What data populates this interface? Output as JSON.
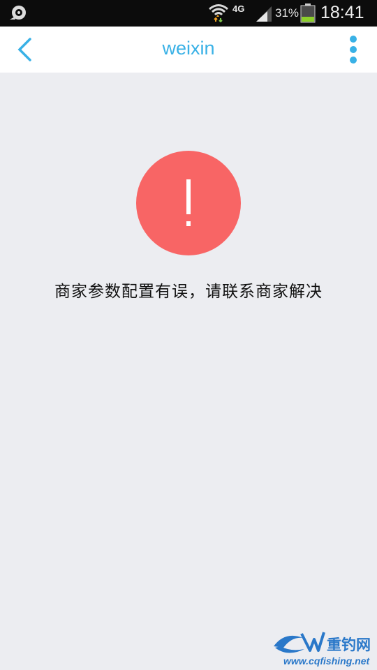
{
  "status_bar": {
    "network_type": "4G",
    "battery_percent": "31%",
    "battery_level": 0.31,
    "time": "18:41"
  },
  "app_bar": {
    "title": "weixin",
    "accent_color": "#39b1e6"
  },
  "error": {
    "icon_glyph": "!",
    "icon_color": "#f86565",
    "message": "商家参数配置有误，请联系商家解决"
  },
  "watermark": {
    "brand": "重钓网",
    "url": "www.cqfishing.net",
    "color": "#2a78c9"
  }
}
